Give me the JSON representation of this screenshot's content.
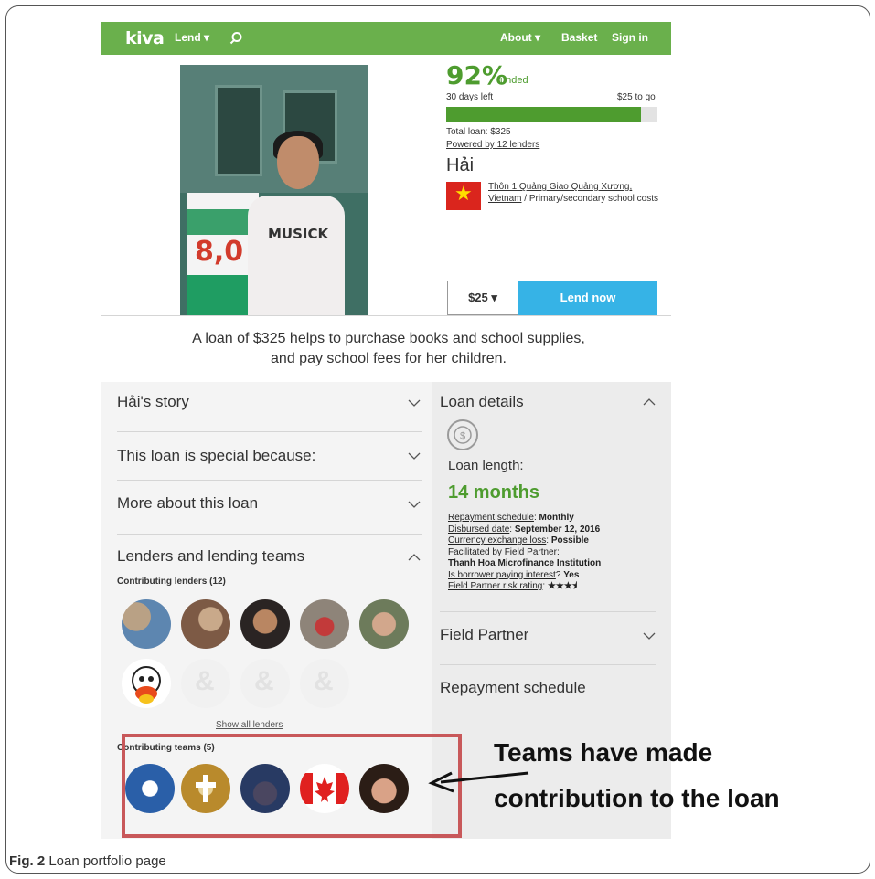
{
  "navbar": {
    "logo": "kiva",
    "lend": "Lend",
    "about": "About",
    "basket": "Basket",
    "sign_in": "Sign in"
  },
  "photo": {
    "sign_text": "8,0",
    "shirt_text": "MUSICK"
  },
  "funding": {
    "percent": "92%",
    "funded_word": "funded",
    "days_left": "30 days left",
    "to_go": "$25 to go",
    "progress_fraction": 0.92,
    "total_loan": "Total loan: $325",
    "powered_by": "Powered by 12 lenders"
  },
  "borrower": {
    "name": "Hải",
    "location_link": "Thôn 1 Quảng Giao Quảng Xương, Vietnam",
    "category": " / Primary/secondary school costs"
  },
  "actions": {
    "amount": "$25",
    "lend_now": "Lend now"
  },
  "description": {
    "line1": "A loan of $325 helps to purchase books and school supplies,",
    "line2": "and pay school fees for her children."
  },
  "left_sections": {
    "story": "Hải's story",
    "special": "This loan is special because:",
    "more": "More about this loan",
    "lenders": "Lenders and lending teams",
    "contributing_lenders": "Contributing lenders (12)",
    "show_all": "Show all lenders",
    "contributing_teams": "Contributing teams (5)"
  },
  "loan_details": {
    "title": "Loan details",
    "loan_length_label": "Loan length",
    "loan_length_colon": ":",
    "months": "14 months",
    "repayment_schedule_key": "Repayment schedule",
    "repayment_schedule_val": "Monthly",
    "disbursed_key": "Disbursed date",
    "disbursed_val": "September 12, 2016",
    "currency_key": "Currency exchange loss",
    "currency_val": "Possible",
    "facilitated_key": "Facilitated by Field Partner",
    "facilitated_val": "Thanh Hoa Microfinance Institution",
    "interest_key": "Is borrower paying interest",
    "interest_val": "Yes",
    "risk_key": "Field Partner risk rating",
    "risk_val": "★★★⯨",
    "field_partner": "Field Partner",
    "repayment_schedule_link": "Repayment schedule"
  },
  "annotation": {
    "line1": "Teams have made",
    "line2": "contribution to the loan"
  },
  "caption": {
    "label": "Fig. 2",
    "text": " Loan portfolio page"
  },
  "colors": {
    "kiva_green": "#6ab04c",
    "funded_green": "#4e9c2f",
    "lend_blue": "#36b3e6",
    "highlight_red": "#c8585a"
  }
}
